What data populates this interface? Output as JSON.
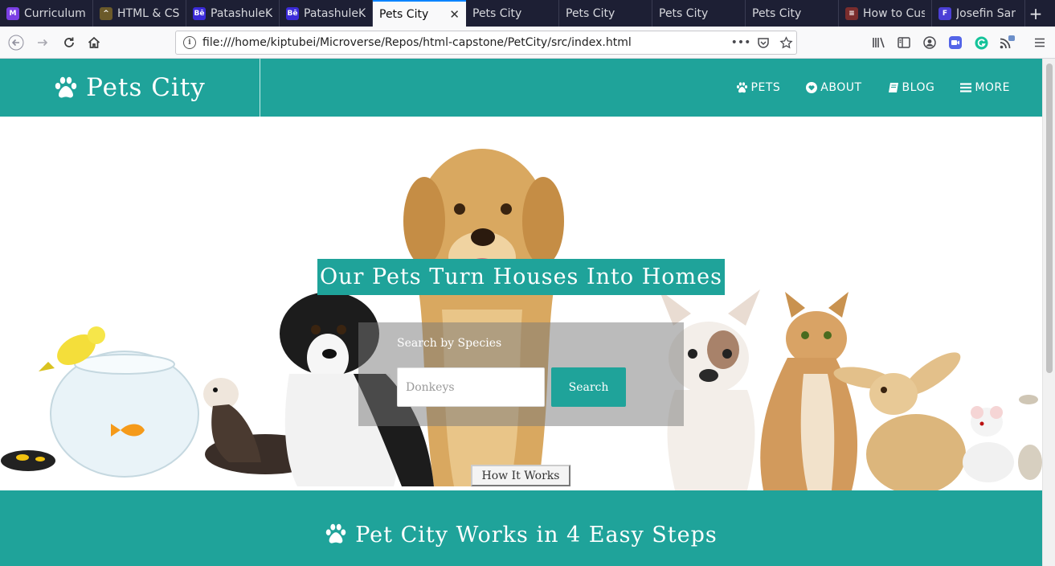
{
  "browser": {
    "tabs": [
      {
        "title": "Curriculum",
        "icon": "microverse-icon",
        "icon_color": "#7b3fe4",
        "active": false
      },
      {
        "title": "HTML & CSS",
        "icon": "graduation-cap-icon",
        "icon_color": "#6b5a2a",
        "active": false
      },
      {
        "title": "PatashuleK",
        "icon": "behance-icon",
        "icon_color": "#3b2bd9",
        "active": false
      },
      {
        "title": "PatashuleK",
        "icon": "behance-icon",
        "icon_color": "#3b2bd9",
        "active": false
      },
      {
        "title": "Pets City",
        "icon": "",
        "icon_color": "",
        "active": true
      },
      {
        "title": "Pets City",
        "icon": "",
        "icon_color": "",
        "active": false
      },
      {
        "title": "Pets City",
        "icon": "",
        "icon_color": "",
        "active": false
      },
      {
        "title": "Pets City",
        "icon": "",
        "icon_color": "",
        "active": false
      },
      {
        "title": "Pets City",
        "icon": "",
        "icon_color": "",
        "active": false
      },
      {
        "title": "How to Cus",
        "icon": "page-icon",
        "icon_color": "#7a2d2d",
        "active": false
      },
      {
        "title": "Josefin Sar",
        "icon": "letter-f-icon",
        "icon_color": "#4b3fd6",
        "active": false
      }
    ],
    "url": "file:///home/kiptubei/Microverse/Repos/html-capstone/PetCity/src/index.html"
  },
  "site": {
    "logo_text": "Pets City",
    "nav": [
      {
        "label": "PETS",
        "icon": "paw-icon"
      },
      {
        "label": "ABOUT",
        "icon": "heart-icon"
      },
      {
        "label": "BLOG",
        "icon": "book-icon"
      },
      {
        "label": "MORE",
        "icon": "menu-icon"
      }
    ],
    "hero": {
      "title": "Our Pets Turn Houses Into Homes",
      "search_label": "Search by Species",
      "search_placeholder": "Donkeys",
      "search_button": "Search",
      "how_button": "How It Works"
    },
    "steps_title": "Pet City Works in 4 Easy Steps"
  },
  "colors": {
    "brand": "#1fa39a",
    "tab_strip": "#1d1f34"
  }
}
